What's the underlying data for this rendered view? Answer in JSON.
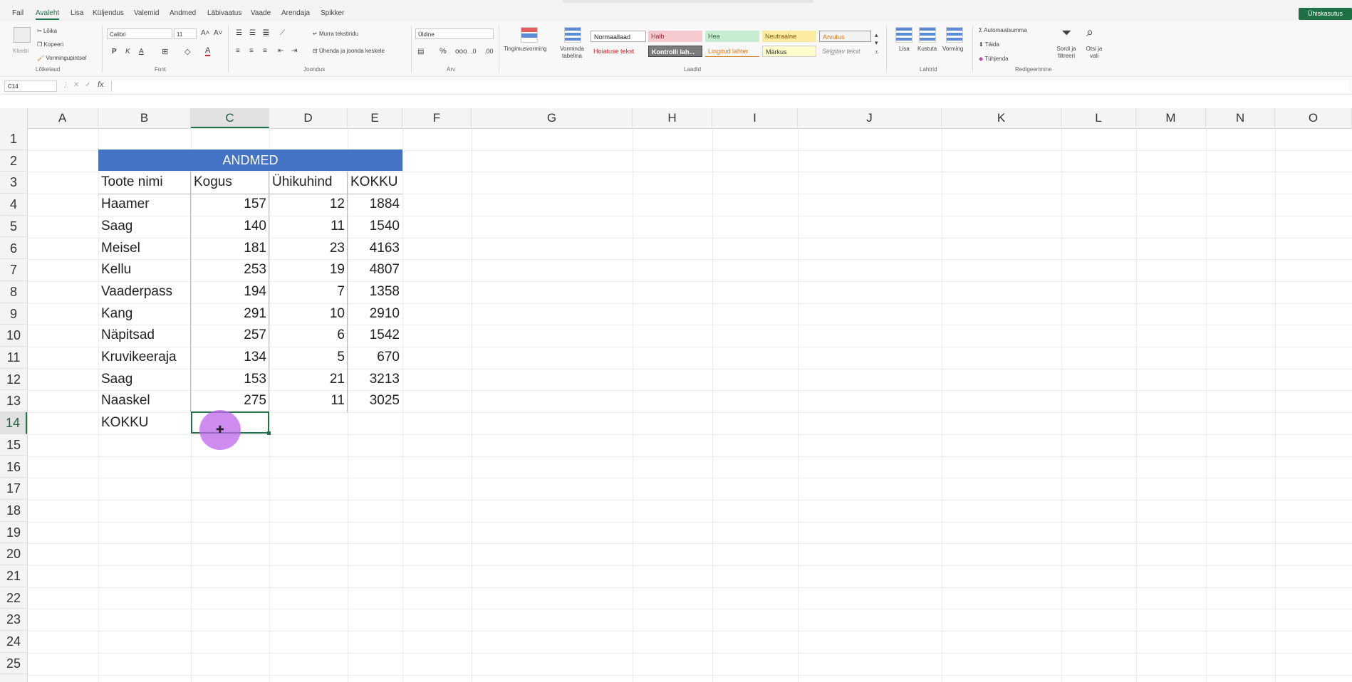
{
  "menu": {
    "items": [
      "Fail",
      "Avaleht",
      "Lisa",
      "Küljendus",
      "Valemid",
      "Andmed",
      "Läbivaatus",
      "Vaade",
      "Arendaja",
      "Spikker"
    ],
    "active": "Avaleht",
    "share_label": "Ühiskasutus"
  },
  "ribbon": {
    "clipboard": {
      "paste": "Kleebi",
      "cut": "Lõika",
      "copy": "Kopeeri",
      "format_painter": "Vormingupintsel",
      "label": "Lõikelaud"
    },
    "font": {
      "name": "Calibri",
      "size": "11",
      "bold": "P",
      "italic": "K",
      "underline": "A",
      "label": "Font"
    },
    "alignment": {
      "wrap": "Murra tekstiridu",
      "merge": "Ühenda ja joonda keskele",
      "label": "Joondus"
    },
    "number": {
      "format": "Üldine",
      "percent": "%",
      "label": "Arv"
    },
    "styles": {
      "conditional": "Tingimusvorming",
      "format_table": "Vorminda tabelina",
      "cells": [
        "Normaallaad",
        "Halb",
        "Hea",
        "Neutraalne",
        "Arvutus",
        "Hoiatuse tekst",
        "Kontrolli lah...",
        "Lingitud lahter",
        "Märkus",
        "Selgitav tekst"
      ],
      "label": "Laadid"
    },
    "cells_group": {
      "insert": "Lisa",
      "delete": "Kustuta",
      "format": "Vorming",
      "label": "Lahtrid"
    },
    "editing": {
      "autosum": "Automaatsumma",
      "fill": "Täida",
      "clear": "Tühjenda",
      "sort": "Sordi ja filtreeri",
      "find": "Otsi ja vali",
      "label": "Redigeerimine"
    }
  },
  "formula_bar": {
    "name_box": "C14",
    "fx": "fx",
    "value": ""
  },
  "columns": [
    "A",
    "B",
    "C",
    "D",
    "E",
    "F",
    "G",
    "H",
    "I",
    "J",
    "K",
    "L",
    "M",
    "N",
    "O"
  ],
  "selected_column": "C",
  "rows": [
    "1",
    "2",
    "3",
    "4",
    "5",
    "6",
    "7",
    "8",
    "9",
    "10",
    "11",
    "12",
    "13",
    "14",
    "15",
    "16",
    "17",
    "18",
    "19",
    "20",
    "21",
    "22",
    "23",
    "24",
    "25"
  ],
  "selected_row": "14",
  "sheet": {
    "table_title": "ANDMED",
    "headers": [
      "Toote nimi",
      "Kogus",
      "Ühikuhind",
      "KOKKU"
    ],
    "data": [
      [
        "Haamer",
        "157",
        "12",
        "1884"
      ],
      [
        "Saag",
        "140",
        "11",
        "1540"
      ],
      [
        "Meisel",
        "181",
        "23",
        "4163"
      ],
      [
        "Kellu",
        "253",
        "19",
        "4807"
      ],
      [
        "Vaaderpass",
        "194",
        "7",
        "1358"
      ],
      [
        "Kang",
        "291",
        "10",
        "2910"
      ],
      [
        "Näpitsad",
        "257",
        "6",
        "1542"
      ],
      [
        "Kruvikeeraja",
        "134",
        "5",
        "670"
      ],
      [
        "Saag",
        "153",
        "21",
        "3213"
      ],
      [
        "Naaskel",
        "275",
        "11",
        "3025"
      ]
    ],
    "total_label": "KOKKU"
  }
}
